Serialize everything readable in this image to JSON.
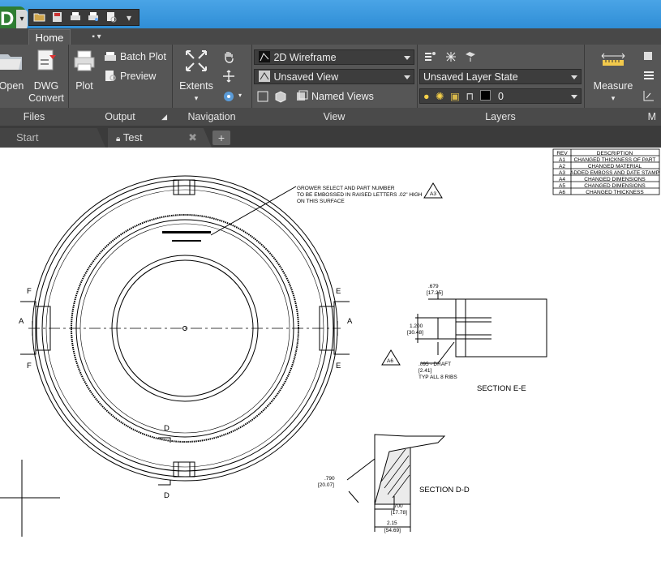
{
  "app": {
    "logo_letter": "D"
  },
  "quick_access": {
    "icons": [
      "open-icon",
      "save-icon",
      "print-icon",
      "plot-preview-icon",
      "publish-icon",
      "dropdown-icon"
    ]
  },
  "ribbon_tabs": {
    "home": "Home",
    "extra": "▪ ▾"
  },
  "files_panel": {
    "title": "Files",
    "open": "Open",
    "dwg_convert_1": "DWG",
    "dwg_convert_2": "Convert"
  },
  "output_panel": {
    "title": "Output",
    "plot": "Plot",
    "batch_plot": "Batch Plot",
    "preview": "Preview"
  },
  "navigation_panel": {
    "title": "Navigation",
    "extents": "Extents"
  },
  "view_panel": {
    "title": "View",
    "visual_style": "2D Wireframe",
    "saved_view": "Unsaved View",
    "named_views": "Named Views"
  },
  "layers_panel": {
    "title": "Layers",
    "layer_state": "Unsaved Layer State",
    "current_layer": "0"
  },
  "measure_panel": {
    "measure": "Measure",
    "title": "M"
  },
  "doc_tabs": {
    "start": "Start",
    "test": "Test",
    "close": "✖",
    "new": "+"
  },
  "drawing": {
    "revision_table": {
      "header": [
        "REV",
        "DESCRIPTION"
      ],
      "rows": [
        [
          "A1",
          "CHANGED THICKNESS OF PART"
        ],
        [
          "A2",
          "CHANGED MATERIAL"
        ],
        [
          "A3",
          "ADDED EMBOSS AND DATE STAMP"
        ],
        [
          "A4",
          "CHANGED DIMENSIONS"
        ],
        [
          "A5",
          "CHANGED DIMENSIONS"
        ],
        [
          "A6",
          "CHANGED THICKNESS"
        ]
      ]
    },
    "note_lines": [
      "GROWER SELECT AND PART NUMBER",
      "TO BE EMBOSSED IN RAISED LETTERS .02\" HIGH",
      "ON THIS SURFACE"
    ],
    "note_tag": "A3",
    "section_ee": {
      "title": "SECTION  E-E",
      "dim1": ".679",
      "dim1_mm": "[17.25]",
      "dim2": "1.200",
      "dim2_mm": "[30.48]",
      "tag": "A6",
      "dim3": ".095  - DRAFT",
      "dim3_mm": "[2.41]",
      "note": "TYP ALL 8 RIBS"
    },
    "section_dd": {
      "title": "SECTION  D-D",
      "dim1": ".790",
      "dim1_mm": "[20.07]",
      "dim2": ".700",
      "dim2_mm": "[17.78]",
      "dim3": "2.15",
      "dim3_mm": "[54.69]"
    },
    "section_letters": {
      "a": "A",
      "e": "E",
      "f": "F",
      "d": "D"
    }
  }
}
